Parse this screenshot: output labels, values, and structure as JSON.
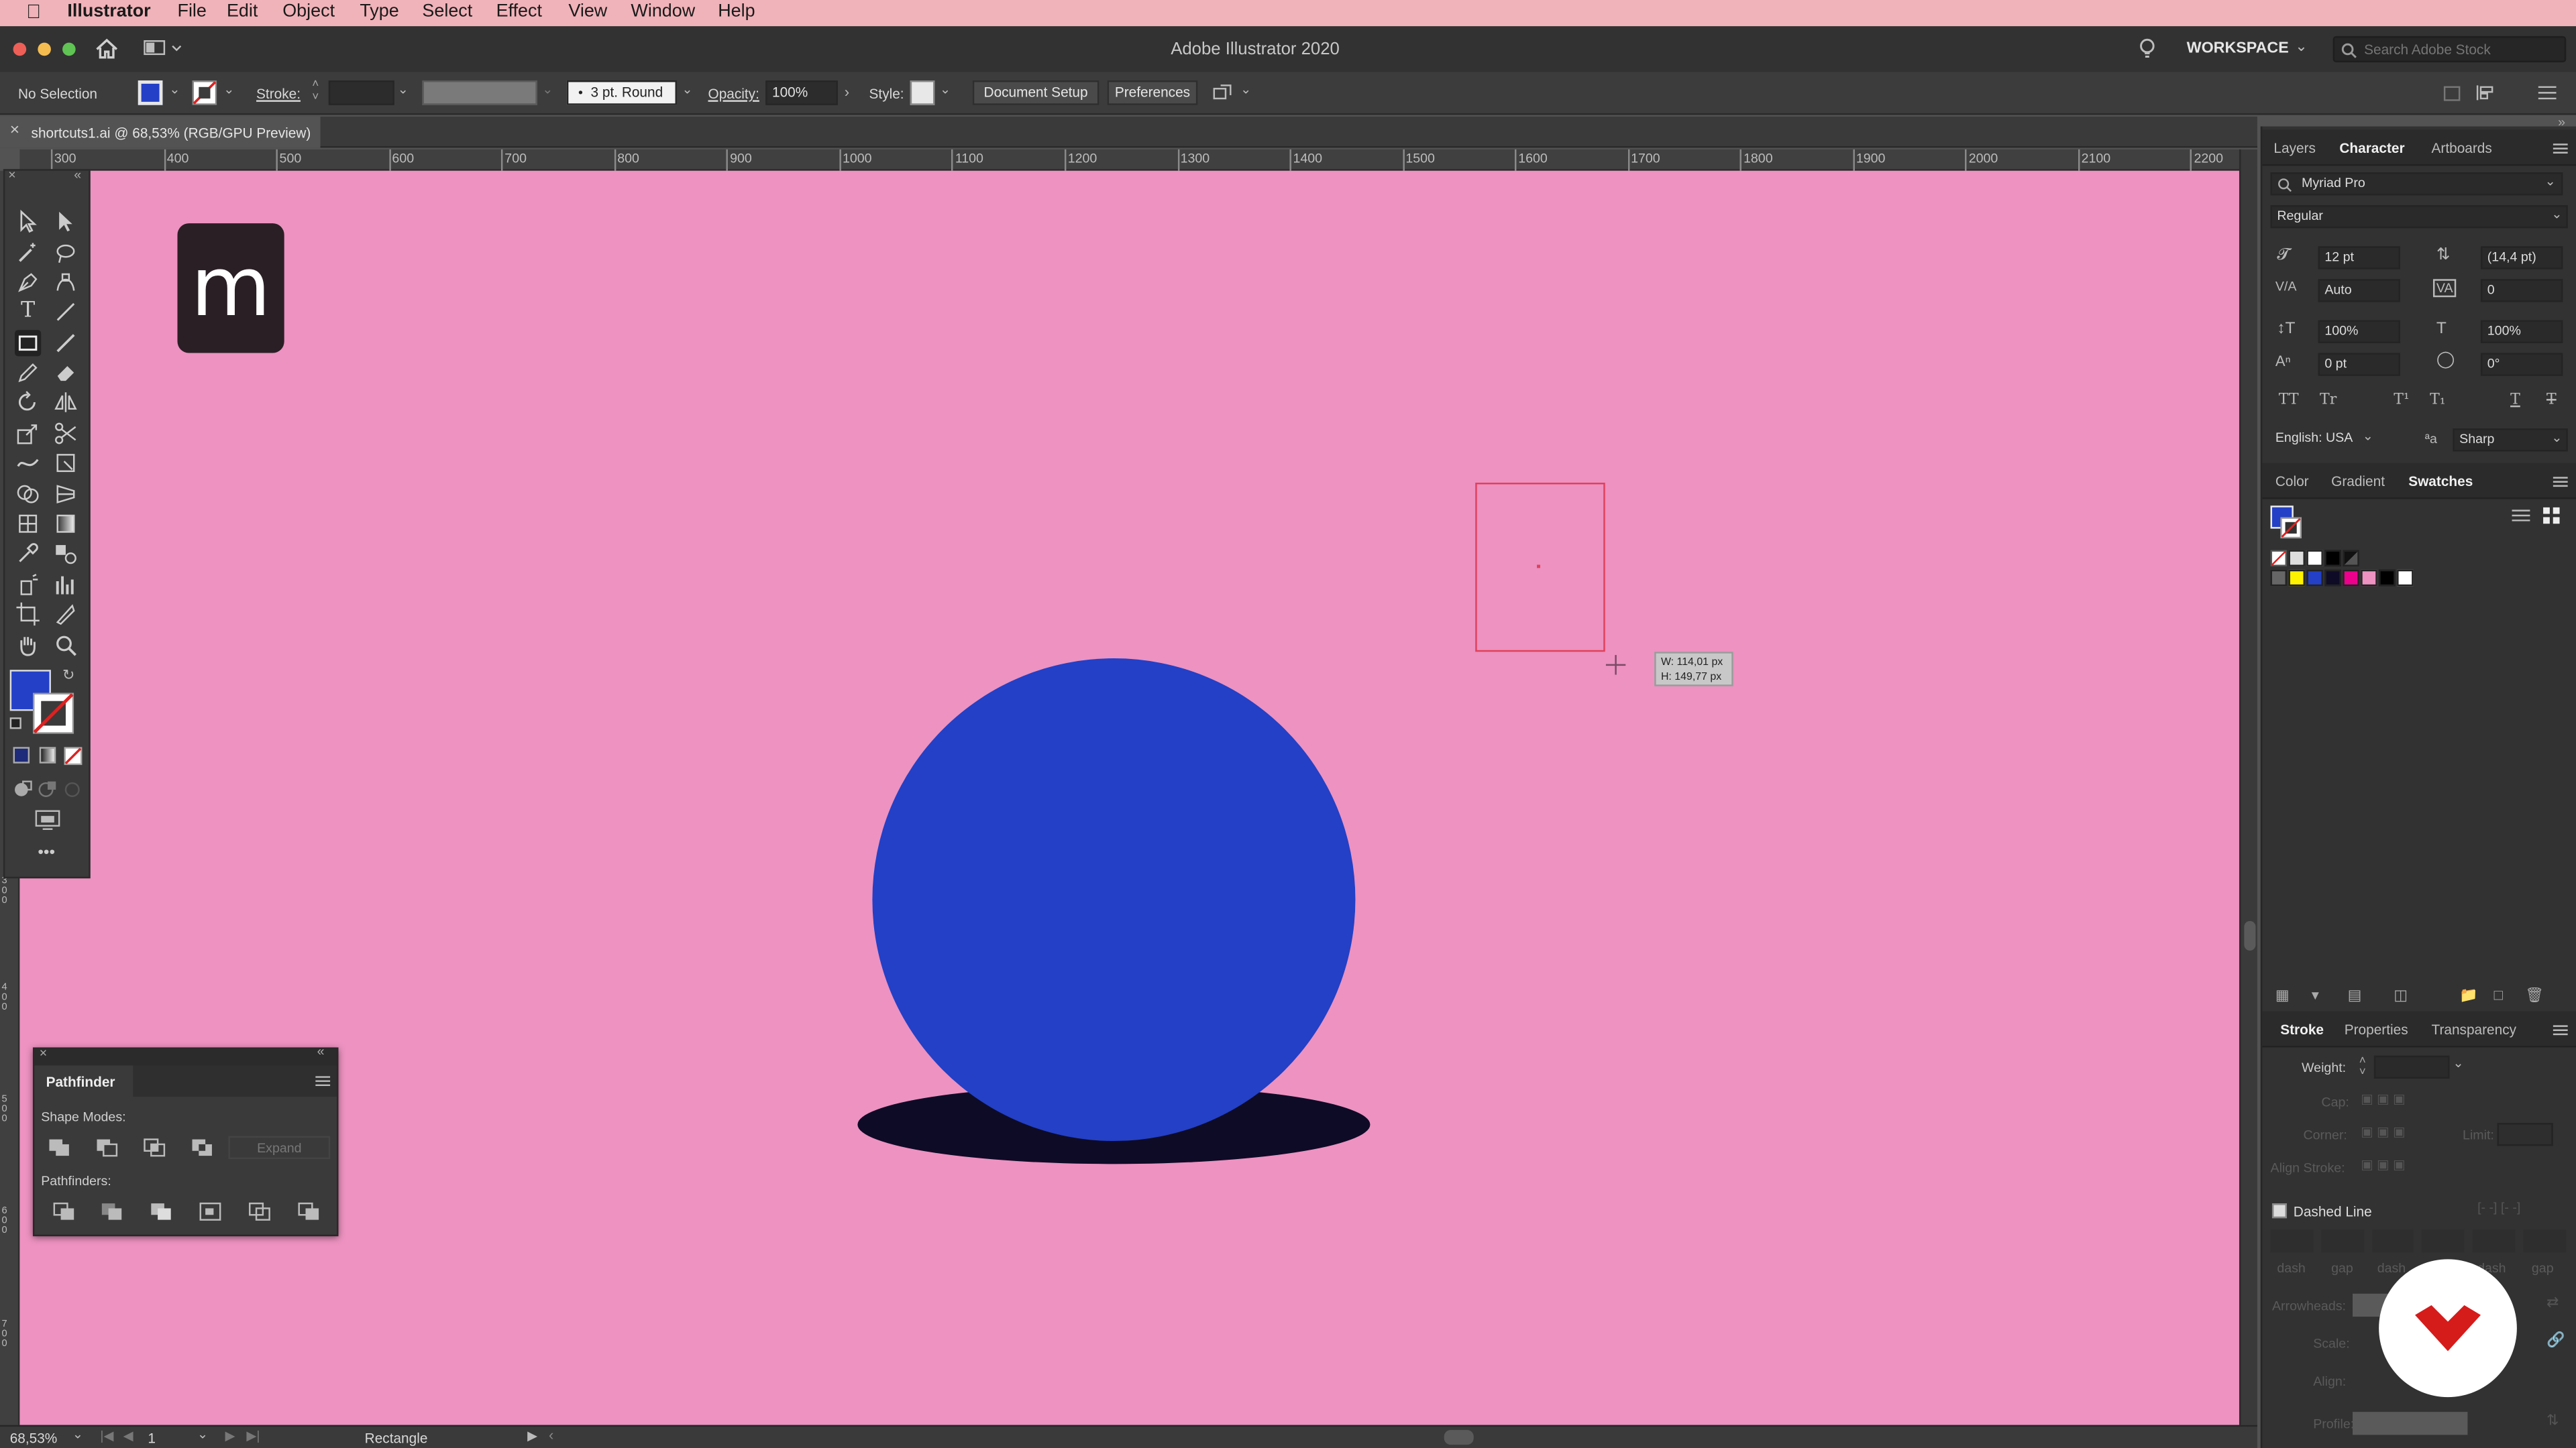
{
  "menubar": {
    "app": "Illustrator",
    "items": [
      "File",
      "Edit",
      "Object",
      "Type",
      "Select",
      "Effect",
      "View",
      "Window",
      "Help"
    ]
  },
  "titlebar": {
    "title": "Adobe Illustrator 2020",
    "workspace": "WORKSPACE",
    "search_placeholder": "Search Adobe Stock"
  },
  "controlbar": {
    "selection": "No Selection",
    "stroke_label": "Stroke:",
    "brush": "3 pt. Round",
    "opacity_label": "Opacity:",
    "opacity_value": "100%",
    "style_label": "Style:",
    "document_setup": "Document Setup",
    "preferences": "Preferences"
  },
  "document_tab": "shortcuts1.ai @ 68,53% (RGB/GPU Preview)",
  "ruler": {
    "ticks": [
      "300",
      "400",
      "500",
      "600",
      "700",
      "800",
      "900",
      "1000",
      "1100",
      "1200",
      "1300",
      "1400",
      "1500",
      "1600",
      "1700",
      "1800",
      "1900",
      "2000",
      "2100",
      "2200"
    ]
  },
  "canvas": {
    "logo_letter": "m",
    "tooltip_w": "W: 114,01 px",
    "tooltip_h": "H: 149,77 px",
    "colors": {
      "artboard": "#ed92c1",
      "circle": "#2340c6",
      "shadow": "#0e0b27",
      "rect_stroke": "#e0405a"
    }
  },
  "pathfinder": {
    "title": "Pathfinder",
    "shape_modes": "Shape Modes:",
    "expand": "Expand",
    "pathfinders": "Pathfinders:"
  },
  "character_panel": {
    "tabs": [
      "Layers",
      "Character",
      "Artboards"
    ],
    "active_tab": "Character",
    "font": "Myriad Pro",
    "style": "Regular",
    "size": "12 pt",
    "leading": "(14,4 pt)",
    "kerning": "Auto",
    "tracking": "0",
    "vscale": "100%",
    "hscale": "100%",
    "baseline": "0 pt",
    "rotation": "0°",
    "language": "English: USA",
    "antialias": "Sharp"
  },
  "swatches_panel": {
    "tabs": [
      "Color",
      "Gradient",
      "Swatches"
    ],
    "active_tab": "Swatches",
    "fill_color": "#2340c6"
  },
  "stroke_panel": {
    "tabs": [
      "Stroke",
      "Properties",
      "Transparency"
    ],
    "active_tab": "Stroke",
    "weight_label": "Weight:",
    "cap_label": "Cap:",
    "corner_label": "Corner:",
    "limit_label": "Limit:",
    "align_label": "Align Stroke:",
    "dashed_line": "Dashed Line",
    "dash_labels": [
      "dash",
      "gap",
      "dash",
      "gap",
      "dash",
      "gap"
    ],
    "arrowheads_label": "Arrowheads:",
    "scale_label": "Scale:",
    "align2_label": "Align:",
    "profile_label": "Profile:"
  },
  "statusbar": {
    "zoom": "68,53%",
    "artboard": "1",
    "tool": "Rectangle"
  }
}
